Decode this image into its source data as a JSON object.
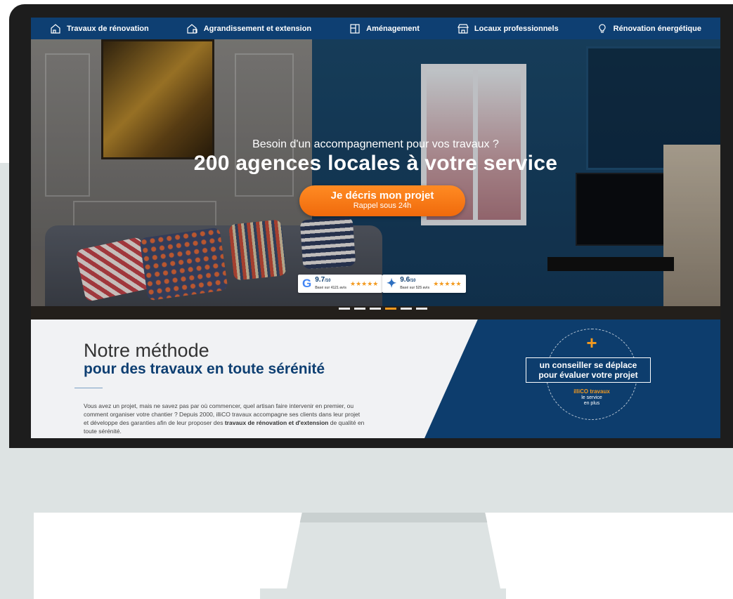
{
  "nav": {
    "items": [
      {
        "label": "Travaux de rénovation",
        "icon": "house-renovation-icon"
      },
      {
        "label": "Agrandissement et extension",
        "icon": "house-extension-icon"
      },
      {
        "label": "Aménagement",
        "icon": "layout-icon"
      },
      {
        "label": "Locaux professionnels",
        "icon": "storefront-icon"
      },
      {
        "label": "Rénovation énergétique",
        "icon": "lightbulb-icon"
      }
    ]
  },
  "hero": {
    "subtitle": "Besoin d'un accompagnement pour vos travaux ?",
    "title": "200 agences locales à votre service",
    "cta_label": "Je décris mon projet",
    "cta_sub": "Rappel sous 24h",
    "ratings": [
      {
        "logo": "G",
        "score": "9.7",
        "scale": "/10",
        "stars": "★★★★★",
        "basis": "Basé sur 4121 avis"
      },
      {
        "logo": "✦",
        "score": "9.6",
        "scale": "/10",
        "stars": "★★★★★",
        "basis": "Basé sur 525 avis"
      }
    ],
    "slides_total": 6,
    "slides_active": 4
  },
  "method": {
    "title_light": "Notre méthode",
    "title_bold": "pour des travaux en toute sérénité",
    "text_plain": "Vous avez un projet, mais ne savez pas par où commencer, quel artisan faire intervenir en premier, ou comment organiser votre chantier ? Depuis 2000, illiCO travaux accompagne ses clients dans leur projet et développe des garanties afin de leur proposer des ",
    "text_bold": "travaux de rénovation et d'extension",
    "text_end": " de qualité en toute sérénité.",
    "badge_plus": "+",
    "badge_line1": "un conseiller se déplace",
    "badge_line2": "pour évaluer votre projet",
    "badge_brand": "illiCO travaux",
    "badge_tag1": "le service",
    "badge_tag2": "en plus"
  },
  "colors": {
    "navy": "#0e3f72",
    "orange": "#f39a1f",
    "monitor_gray": "#dde3e3"
  }
}
